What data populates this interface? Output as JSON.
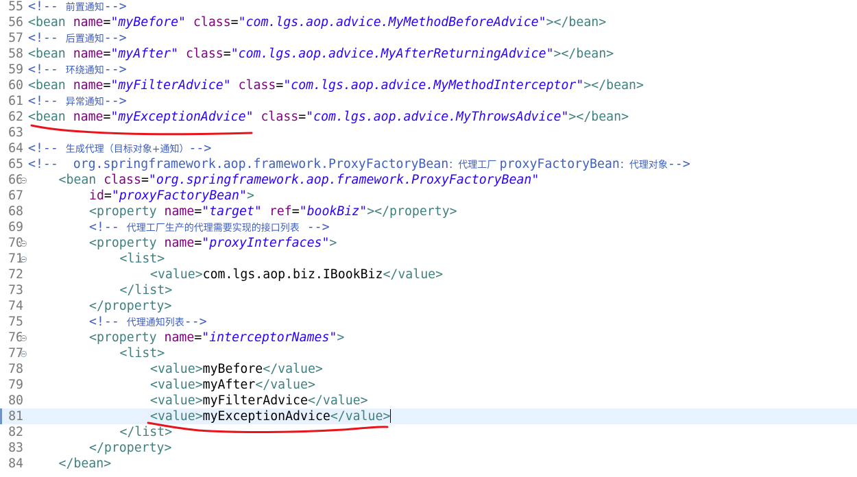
{
  "editor": {
    "lines": [
      {
        "num": "55",
        "indent": 0,
        "fold": false,
        "current": false,
        "tokens": [
          {
            "t": "cmt",
            "v": "<!-- "
          },
          {
            "t": "cmt-cn",
            "v": "前置通知"
          },
          {
            "t": "cmt",
            "v": "-->"
          }
        ]
      },
      {
        "num": "56",
        "indent": 0,
        "fold": false,
        "current": false,
        "tokens": [
          {
            "t": "tag",
            "v": "<bean "
          },
          {
            "t": "attr",
            "v": "name"
          },
          {
            "t": "eq",
            "v": "="
          },
          {
            "t": "val",
            "v": "\"myBefore\""
          },
          {
            "t": "txt",
            "v": " "
          },
          {
            "t": "attr",
            "v": "class"
          },
          {
            "t": "eq",
            "v": "="
          },
          {
            "t": "val",
            "v": "\"com.lgs.aop.advice.MyMethodBeforeAdvice\""
          },
          {
            "t": "tag",
            "v": "></bean>"
          }
        ]
      },
      {
        "num": "57",
        "indent": 0,
        "fold": false,
        "current": false,
        "tokens": [
          {
            "t": "cmt",
            "v": "<!-- "
          },
          {
            "t": "cmt-cn",
            "v": "后置通知"
          },
          {
            "t": "cmt",
            "v": "-->"
          }
        ]
      },
      {
        "num": "58",
        "indent": 0,
        "fold": false,
        "current": false,
        "tokens": [
          {
            "t": "tag",
            "v": "<bean "
          },
          {
            "t": "attr",
            "v": "name"
          },
          {
            "t": "eq",
            "v": "="
          },
          {
            "t": "val",
            "v": "\"myAfter\""
          },
          {
            "t": "txt",
            "v": " "
          },
          {
            "t": "attr",
            "v": "class"
          },
          {
            "t": "eq",
            "v": "="
          },
          {
            "t": "val",
            "v": "\"com.lgs.aop.advice.MyAfterReturningAdvice\""
          },
          {
            "t": "tag",
            "v": "></bean>"
          }
        ]
      },
      {
        "num": "59",
        "indent": 0,
        "fold": false,
        "current": false,
        "tokens": [
          {
            "t": "cmt",
            "v": "<!-- "
          },
          {
            "t": "cmt-cn",
            "v": "环绕通知"
          },
          {
            "t": "cmt",
            "v": "-->"
          }
        ]
      },
      {
        "num": "60",
        "indent": 0,
        "fold": false,
        "current": false,
        "tokens": [
          {
            "t": "tag",
            "v": "<bean "
          },
          {
            "t": "attr",
            "v": "name"
          },
          {
            "t": "eq",
            "v": "="
          },
          {
            "t": "val",
            "v": "\"myFilterAdvice\""
          },
          {
            "t": "txt",
            "v": " "
          },
          {
            "t": "attr",
            "v": "class"
          },
          {
            "t": "eq",
            "v": "="
          },
          {
            "t": "val",
            "v": "\"com.lgs.aop.advice.MyMethodInterceptor\""
          },
          {
            "t": "tag",
            "v": "></bean>"
          }
        ]
      },
      {
        "num": "61",
        "indent": 0,
        "fold": false,
        "current": false,
        "tokens": [
          {
            "t": "cmt",
            "v": "<!-- "
          },
          {
            "t": "cmt-cn",
            "v": "异常通知"
          },
          {
            "t": "cmt",
            "v": "-->"
          }
        ]
      },
      {
        "num": "62",
        "indent": 0,
        "fold": false,
        "current": false,
        "tokens": [
          {
            "t": "tag",
            "v": "<bean "
          },
          {
            "t": "attr",
            "v": "name"
          },
          {
            "t": "eq",
            "v": "="
          },
          {
            "t": "val",
            "v": "\"myExceptionAdvice\""
          },
          {
            "t": "txt",
            "v": " "
          },
          {
            "t": "attr",
            "v": "class"
          },
          {
            "t": "eq",
            "v": "="
          },
          {
            "t": "val",
            "v": "\"com.lgs.aop.advice.MyThrowsAdvice\""
          },
          {
            "t": "tag",
            "v": "></bean>"
          }
        ]
      },
      {
        "num": "63",
        "indent": 0,
        "fold": false,
        "current": false,
        "tokens": []
      },
      {
        "num": "64",
        "indent": 0,
        "fold": false,
        "current": false,
        "tokens": [
          {
            "t": "cmt",
            "v": "<!-- "
          },
          {
            "t": "cmt-cn",
            "v": "生成代理（目标对象+通知）"
          },
          {
            "t": "cmt",
            "v": "-->"
          }
        ]
      },
      {
        "num": "65",
        "indent": 0,
        "fold": false,
        "current": false,
        "tokens": [
          {
            "t": "cmt",
            "v": "<!--  org.springframework.aop.framework.ProxyFactoryBean"
          },
          {
            "t": "cmt-cn",
            "v": "：代理工厂 "
          },
          {
            "t": "cmt",
            "v": "proxyFactoryBean"
          },
          {
            "t": "cmt-cn",
            "v": "：代理对象"
          },
          {
            "t": "cmt",
            "v": "-->"
          }
        ]
      },
      {
        "num": "66",
        "indent": 1,
        "fold": true,
        "current": false,
        "tokens": [
          {
            "t": "tag",
            "v": "<bean "
          },
          {
            "t": "attr",
            "v": "class"
          },
          {
            "t": "eq",
            "v": "="
          },
          {
            "t": "val",
            "v": "\"org.springframework.aop.framework.ProxyFactoryBean\""
          }
        ]
      },
      {
        "num": "67",
        "indent": 2,
        "fold": false,
        "current": false,
        "tokens": [
          {
            "t": "attr",
            "v": "id"
          },
          {
            "t": "eq",
            "v": "="
          },
          {
            "t": "val",
            "v": "\"proxyFactoryBean\""
          },
          {
            "t": "tag",
            "v": ">"
          }
        ]
      },
      {
        "num": "68",
        "indent": 2,
        "fold": false,
        "current": false,
        "tokens": [
          {
            "t": "tag",
            "v": "<property "
          },
          {
            "t": "attr",
            "v": "name"
          },
          {
            "t": "eq",
            "v": "="
          },
          {
            "t": "val",
            "v": "\"target\""
          },
          {
            "t": "txt",
            "v": " "
          },
          {
            "t": "attr",
            "v": "ref"
          },
          {
            "t": "eq",
            "v": "="
          },
          {
            "t": "val",
            "v": "\"bookBiz\""
          },
          {
            "t": "tag",
            "v": "></property>"
          }
        ]
      },
      {
        "num": "69",
        "indent": 2,
        "fold": false,
        "current": false,
        "tokens": [
          {
            "t": "cmt",
            "v": "<!-- "
          },
          {
            "t": "cmt-cn",
            "v": "代理工厂生产的代理需要实现的接口列表"
          },
          {
            "t": "cmt",
            "v": " -->"
          }
        ]
      },
      {
        "num": "70",
        "indent": 2,
        "fold": true,
        "current": false,
        "tokens": [
          {
            "t": "tag",
            "v": "<property "
          },
          {
            "t": "attr",
            "v": "name"
          },
          {
            "t": "eq",
            "v": "="
          },
          {
            "t": "val",
            "v": "\"proxyInterfaces\""
          },
          {
            "t": "tag",
            "v": ">"
          }
        ]
      },
      {
        "num": "71",
        "indent": 3,
        "fold": true,
        "current": false,
        "tokens": [
          {
            "t": "tag",
            "v": "<list>"
          }
        ]
      },
      {
        "num": "72",
        "indent": 4,
        "fold": false,
        "current": false,
        "tokens": [
          {
            "t": "tag",
            "v": "<value>"
          },
          {
            "t": "txt",
            "v": "com.lgs.aop.biz.IBookBiz"
          },
          {
            "t": "tag",
            "v": "</value>"
          }
        ]
      },
      {
        "num": "73",
        "indent": 3,
        "fold": false,
        "current": false,
        "tokens": [
          {
            "t": "tag",
            "v": "</list>"
          }
        ]
      },
      {
        "num": "74",
        "indent": 2,
        "fold": false,
        "current": false,
        "tokens": [
          {
            "t": "tag",
            "v": "</property>"
          }
        ]
      },
      {
        "num": "75",
        "indent": 2,
        "fold": false,
        "current": false,
        "tokens": [
          {
            "t": "cmt",
            "v": "<!-- "
          },
          {
            "t": "cmt-cn",
            "v": "代理通知列表"
          },
          {
            "t": "cmt",
            "v": "-->"
          }
        ]
      },
      {
        "num": "76",
        "indent": 2,
        "fold": true,
        "current": false,
        "tokens": [
          {
            "t": "tag",
            "v": "<property "
          },
          {
            "t": "attr",
            "v": "name"
          },
          {
            "t": "eq",
            "v": "="
          },
          {
            "t": "val",
            "v": "\"interceptorNames\""
          },
          {
            "t": "tag",
            "v": ">"
          }
        ]
      },
      {
        "num": "77",
        "indent": 3,
        "fold": true,
        "current": false,
        "tokens": [
          {
            "t": "tag",
            "v": "<list>"
          }
        ]
      },
      {
        "num": "78",
        "indent": 4,
        "fold": false,
        "current": false,
        "tokens": [
          {
            "t": "tag",
            "v": "<value>"
          },
          {
            "t": "txt",
            "v": "myBefore"
          },
          {
            "t": "tag",
            "v": "</value>"
          }
        ]
      },
      {
        "num": "79",
        "indent": 4,
        "fold": false,
        "current": false,
        "tokens": [
          {
            "t": "tag",
            "v": "<value>"
          },
          {
            "t": "txt",
            "v": "myAfter"
          },
          {
            "t": "tag",
            "v": "</value>"
          }
        ]
      },
      {
        "num": "80",
        "indent": 4,
        "fold": false,
        "current": false,
        "tokens": [
          {
            "t": "tag",
            "v": "<value>"
          },
          {
            "t": "txt",
            "v": "myFilterAdvice"
          },
          {
            "t": "tag",
            "v": "</value>"
          }
        ]
      },
      {
        "num": "81",
        "indent": 4,
        "fold": false,
        "current": true,
        "tokens": [
          {
            "t": "tag",
            "v": "<value>"
          },
          {
            "t": "txt",
            "v": "myExceptionAdvice"
          },
          {
            "t": "tag",
            "v": "</value>"
          }
        ]
      },
      {
        "num": "82",
        "indent": 3,
        "fold": false,
        "current": false,
        "tokens": [
          {
            "t": "tag",
            "v": "</list>"
          }
        ]
      },
      {
        "num": "83",
        "indent": 2,
        "fold": false,
        "current": false,
        "tokens": [
          {
            "t": "tag",
            "v": "</property>"
          }
        ]
      },
      {
        "num": "84",
        "indent": 1,
        "fold": false,
        "current": false,
        "tokens": [
          {
            "t": "tag",
            "v": "</bean>"
          }
        ]
      }
    ]
  },
  "colors": {
    "tag": "#3f7f7f",
    "attribute": "#7f007f",
    "attribute_value": "#2a00ff",
    "comment": "#3f5fbf",
    "line_number": "#787878",
    "current_line_highlight": "#e8f2fe",
    "annotation_underline": "#e8141b"
  },
  "icons": {
    "fold": "fold-collapse-icon"
  }
}
